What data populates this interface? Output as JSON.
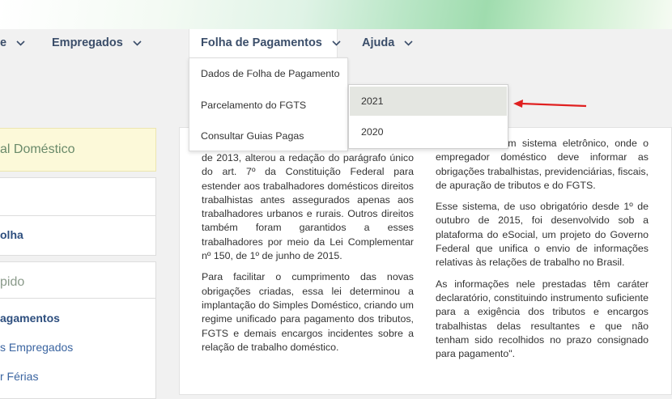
{
  "nav": {
    "item_partial": "e",
    "empregados": "Empregados",
    "folha": "Folha de Pagamentos",
    "ajuda": "Ajuda"
  },
  "dropdown": {
    "items": [
      "Dados de Folha de Pagamento",
      "Parcelamento do FGTS",
      "Consultar Guias Pagas"
    ]
  },
  "submenu": {
    "items": [
      "2021",
      "2020"
    ]
  },
  "sidebar": {
    "banner": "al Doméstico",
    "folha_link": "olha",
    "section_heading": "pido",
    "links": [
      "agamentos",
      "s Empregados",
      "r Férias"
    ]
  },
  "content": {
    "left_paragraphs": [
      "de 2013, alterou a redação do parágrafo único do art. 7º da Constituição Federal para estender aos trabalhadores domésticos direitos trabalhistas antes assegurados apenas aos trabalhadores urbanos e rurais. Outros direitos também foram garantidos a esses trabalhadores por meio da Lei Complementar nº 150, de 1º de junho de 2015.",
      "Para facilitar o cumprimento das novas obrigações criadas, essa lei determinou a implantação do Simples Doméstico, criando um regime unificado para pagamento dos tributos, FGTS e demais encargos incidentes sobre a relação de trabalho doméstico."
    ],
    "right_paragraphs": [
      "a criação de um sistema eletrônico, onde o empregador doméstico deve informar as obrigações trabalhistas, previdenciárias, fiscais, de apuração de tributos e do FGTS.",
      "Esse sistema, de uso obrigatório desde 1º de outubro de 2015, foi desenvolvido sob a plataforma do eSocial, um projeto do Governo Federal que unifica o envio de informações relativas às relações de trabalho no Brasil.",
      "As informações nele prestadas têm caráter declaratório, constituindo instrumento suficiente para a exigência dos tributos e encargos trabalhistas delas resultantes e que não tenham sido recolhidos no prazo consignado para pagamento\"."
    ]
  },
  "colors": {
    "nav_text": "#3b4e6a",
    "annotation_arrow": "#e02020",
    "highlight": "#e4e6e1"
  },
  "icons": [
    "chevron-down-icon",
    "red-arrow-annotation"
  ]
}
